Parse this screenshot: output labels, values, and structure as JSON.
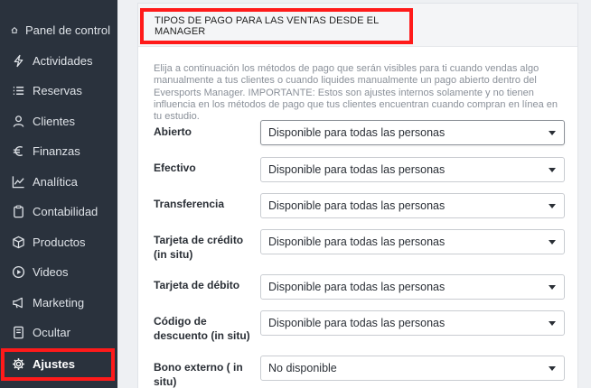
{
  "sidebar": {
    "items": [
      {
        "label": "Panel de control",
        "icon": "home-icon"
      },
      {
        "label": "Actividades",
        "icon": "lightning-icon"
      },
      {
        "label": "Reservas",
        "icon": "list-icon"
      },
      {
        "label": "Clientes",
        "icon": "user-icon"
      },
      {
        "label": "Finanzas",
        "icon": "euro-icon"
      },
      {
        "label": "Analítica",
        "icon": "chart-icon"
      },
      {
        "label": "Contabilidad",
        "icon": "clipboard-icon"
      },
      {
        "label": "Productos",
        "icon": "box-icon"
      },
      {
        "label": "Videos",
        "icon": "play-icon"
      },
      {
        "label": "Marketing",
        "icon": "megaphone-icon"
      },
      {
        "label": "Ocultar",
        "icon": "document-icon"
      },
      {
        "label": "Ajustes",
        "icon": "gear-icon",
        "active": true
      }
    ]
  },
  "panel": {
    "title": "TIPOS DE PAGO PARA LAS VENTAS DESDE EL MANAGER",
    "description": "Elija a continuación los métodos de pago que serán visibles para ti cuando vendas algo manualmente a tus clientes o cuando liquides manualmente un pago abierto dentro del Eversports Manager. IMPORTANTE: Estos son ajustes internos solamente y no tienen influencia en los métodos de pago que tus clientes encuentran cuando compran en línea en tu estudio.",
    "rows": [
      {
        "label": "Abierto",
        "value": "Disponible para todas las personas"
      },
      {
        "label": "Efectivo",
        "value": "Disponible para todas las personas"
      },
      {
        "label": "Transferencia",
        "value": "Disponible para todas las personas"
      },
      {
        "label": "Tarjeta de crédito (in situ)",
        "value": "Disponible para todas las personas"
      },
      {
        "label": "Tarjeta de débito",
        "value": "Disponible para todas las personas"
      },
      {
        "label": "Código de descuento (in situ)",
        "value": "Disponible para todas las personas"
      },
      {
        "label": "Bono externo ( in situ)",
        "value": "No disponible"
      }
    ]
  },
  "colors": {
    "sidebar_bg": "#2a323d",
    "highlight": "#ff1a1a"
  }
}
